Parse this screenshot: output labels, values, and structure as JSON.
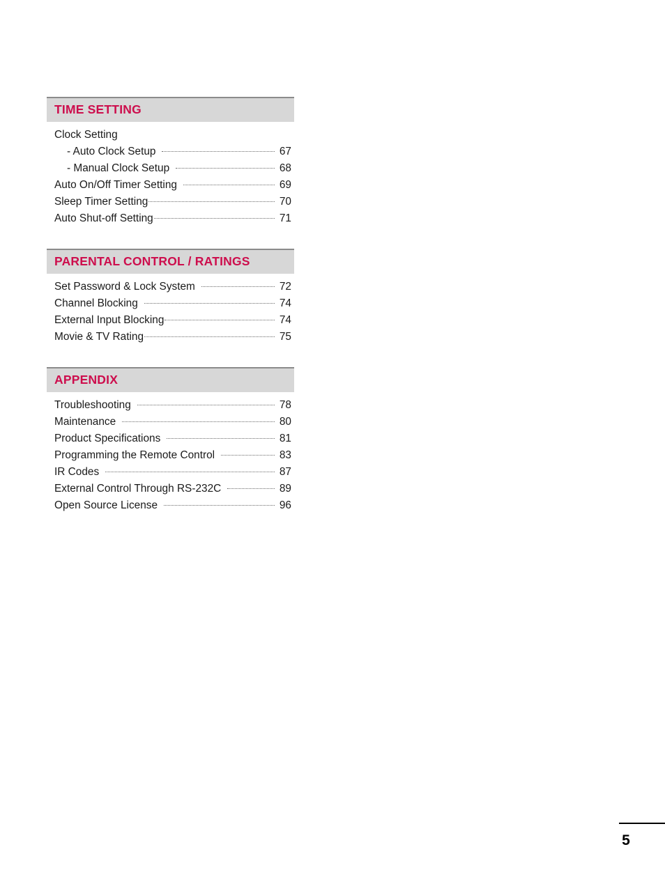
{
  "document": {
    "page_number": "5"
  },
  "sections": [
    {
      "title": "TIME SETTING",
      "entries": [
        {
          "label": "Clock Setting",
          "page": "",
          "indent": false,
          "leader": false
        },
        {
          "label": "- Auto Clock Setup",
          "page": "67",
          "indent": true,
          "leader": true,
          "wide_gap": true
        },
        {
          "label": "- Manual Clock Setup",
          "page": "68",
          "indent": true,
          "leader": true,
          "wide_gap": true
        },
        {
          "label": "Auto On/Off Timer Setting",
          "page": "69",
          "indent": false,
          "leader": true,
          "wide_gap": true
        },
        {
          "label": "Sleep Timer Setting",
          "page": "70",
          "indent": false,
          "leader": true,
          "wide_gap": false
        },
        {
          "label": "Auto Shut-off Setting",
          "page": "71",
          "indent": false,
          "leader": true,
          "wide_gap": false
        }
      ]
    },
    {
      "title": "PARENTAL CONTROL / RATINGS",
      "entries": [
        {
          "label": "Set Password & Lock System",
          "page": "72",
          "indent": false,
          "leader": true,
          "wide_gap": true
        },
        {
          "label": "Channel Blocking",
          "page": "74",
          "indent": false,
          "leader": true,
          "wide_gap": true
        },
        {
          "label": "External Input Blocking",
          "page": "74",
          "indent": false,
          "leader": true,
          "wide_gap": false
        },
        {
          "label": "Movie & TV Rating",
          "page": "75",
          "indent": false,
          "leader": true,
          "wide_gap": false
        }
      ]
    },
    {
      "title": "APPENDIX",
      "entries": [
        {
          "label": "Troubleshooting",
          "page": "78",
          "indent": false,
          "leader": true,
          "wide_gap": true
        },
        {
          "label": "Maintenance",
          "page": "80",
          "indent": false,
          "leader": true,
          "wide_gap": true
        },
        {
          "label": "Product Specifications",
          "page": "81",
          "indent": false,
          "leader": true,
          "wide_gap": true
        },
        {
          "label": "Programming the Remote Control",
          "page": "83",
          "indent": false,
          "leader": true,
          "wide_gap": true
        },
        {
          "label": "IR Codes",
          "page": "87",
          "indent": false,
          "leader": true,
          "wide_gap": true
        },
        {
          "label": "External Control Through RS-232C",
          "page": "89",
          "indent": false,
          "leader": true,
          "wide_gap": true
        },
        {
          "label": "Open Source License",
          "page": "96",
          "indent": false,
          "leader": true,
          "wide_gap": true
        }
      ]
    }
  ],
  "colors": {
    "accent": "#cd0e4d",
    "header_bar": "#d7d7d7",
    "header_rule": "#8b8b8b",
    "text": "#1a1a1a"
  }
}
